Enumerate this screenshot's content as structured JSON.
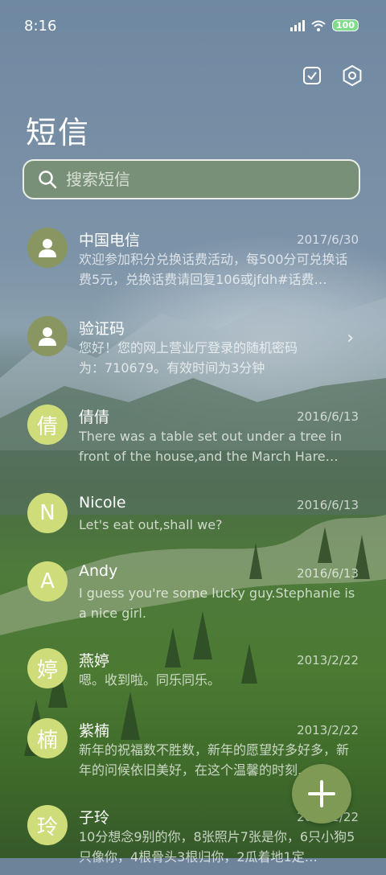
{
  "status": {
    "time": "8:16",
    "battery": "100"
  },
  "header": {
    "title": "短信"
  },
  "search": {
    "placeholder": "搜索短信"
  },
  "messages": [
    {
      "avatar_type": "person",
      "avatar_text": "",
      "name": "中国电信",
      "date": "2017/6/30",
      "preview": "欢迎参加积分兑换话费活动，每500分可兑换话费5元，兑换话费请回复106或jfdh#话费…",
      "has_chevron": false
    },
    {
      "avatar_type": "person",
      "avatar_text": "",
      "name": "验证码",
      "date": "",
      "preview": "您好！您的网上营业厅登录的随机密码为：710679。有效时间为3分钟",
      "has_chevron": true
    },
    {
      "avatar_type": "letter",
      "avatar_text": "倩",
      "name": "倩倩",
      "date": "2016/6/13",
      "preview": "There was a table set out under a tree in front of the house,and the March Hare an…",
      "has_chevron": false
    },
    {
      "avatar_type": "letter",
      "avatar_text": "N",
      "name": "Nicole",
      "date": "2016/6/13",
      "preview": "Let's eat out,shall we?",
      "has_chevron": false
    },
    {
      "avatar_type": "letter",
      "avatar_text": "A",
      "name": "Andy",
      "date": "2016/6/13",
      "preview": "I guess you're some lucky guy.Stephanie is a nice girl.",
      "has_chevron": false
    },
    {
      "avatar_type": "letter",
      "avatar_text": "婷",
      "name": "燕婷",
      "date": "2013/2/22",
      "preview": "嗯。收到啦。同乐同乐。",
      "has_chevron": false
    },
    {
      "avatar_type": "letter",
      "avatar_text": "楠",
      "name": "紫楠",
      "date": "2013/2/22",
      "preview": "新年的祝福数不胜数，新年的愿望好多好多，新年的问候依旧美好，在这个温馨的时刻…",
      "has_chevron": false
    },
    {
      "avatar_type": "letter",
      "avatar_text": "玲",
      "name": "子玲",
      "date": "2013/2/22",
      "preview": "10分想念9别的你，8张照片7张是你，6只小狗5只像你，4根骨头3根归你，2瓜着地1定…",
      "has_chevron": false
    }
  ],
  "icons": {
    "select": "checkbox-icon",
    "settings": "gear-icon",
    "search": "search-icon",
    "compose": "plus-icon"
  },
  "colors": {
    "fab": "#7e9a55",
    "letter_avatar": "#cfdc7a",
    "person_avatar": "#8a9662"
  }
}
